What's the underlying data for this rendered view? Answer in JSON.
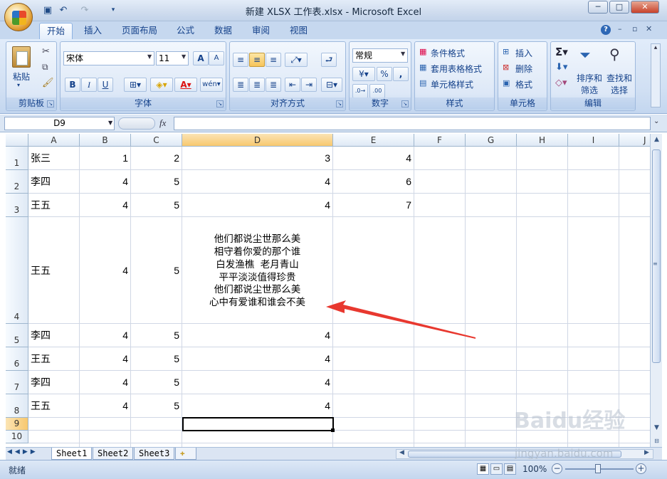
{
  "window": {
    "title": "新建 XLSX 工作表.xlsx - Microsoft Excel",
    "controls": [
      "─",
      "□",
      "✕"
    ]
  },
  "ribbon": {
    "tabs": [
      "开始",
      "插入",
      "页面布局",
      "公式",
      "数据",
      "审阅",
      "视图"
    ],
    "clipboard": {
      "paste": "粘贴",
      "label": "剪贴板"
    },
    "font": {
      "name": "宋体",
      "size": "11",
      "grow": "A",
      "shrink": "A",
      "bold": "B",
      "italic": "I",
      "underline": "U",
      "label": "字体"
    },
    "alignment": {
      "label": "对齐方式"
    },
    "number": {
      "format": "常规",
      "percent": "%",
      "comma": ",",
      "label": "数字"
    },
    "styles": {
      "conditional": "条件格式",
      "table": "套用表格格式",
      "cell": "单元格样式",
      "label": "样式"
    },
    "cells": {
      "insert": "插入",
      "delete": "删除",
      "format": "格式",
      "label": "单元格"
    },
    "editing": {
      "sort": "排序和",
      "sort2": "筛选",
      "find": "查找和",
      "find2": "选择",
      "label": "编辑"
    }
  },
  "formula_bar": {
    "name_box": "D9",
    "fx": "fx",
    "value": ""
  },
  "sheet": {
    "columns": [
      "A",
      "B",
      "C",
      "D",
      "E",
      "F",
      "G",
      "H",
      "I",
      "J"
    ],
    "rows": [
      "1",
      "2",
      "3",
      "4",
      "5",
      "6",
      "7",
      "8",
      "9",
      "10"
    ],
    "cells": {
      "A1": "张三",
      "B1": "1",
      "C1": "2",
      "D1": "3",
      "E1": "4",
      "A2": "李四",
      "B2": "4",
      "C2": "5",
      "D2": "4",
      "E2": "6",
      "A3": "王五",
      "B3": "4",
      "C3": "5",
      "D3": "4",
      "E3": "7",
      "A4": "王五",
      "B4": "4",
      "C4": "5",
      "A5": "李四",
      "B5": "4",
      "C5": "5",
      "D5": "4",
      "A6": "王五",
      "B6": "4",
      "C6": "5",
      "D6": "4",
      "A7": "李四",
      "B7": "4",
      "C7": "5",
      "D7": "4",
      "A8": "王五",
      "B8": "4",
      "C8": "5",
      "D8": "4"
    },
    "poem_lines": [
      "他们都说尘世那么美",
      "相守着你爱的那个谁",
      "白发渔樵  老月青山",
      "平平淡淡值得珍贵",
      "他们都说尘世那么美",
      "心中有爱谁和谁会不美"
    ],
    "active_cell": "D9"
  },
  "sheet_tabs": [
    "Sheet1",
    "Sheet2",
    "Sheet3"
  ],
  "status": {
    "text": "就绪",
    "zoom": "100%"
  },
  "watermark": {
    "logo": "Baidu经验",
    "url": "jingyan.baidu.com"
  },
  "colors": {
    "accent": "#15428b",
    "arrow": "#e8382f",
    "selected_header": "#f7c86f"
  }
}
